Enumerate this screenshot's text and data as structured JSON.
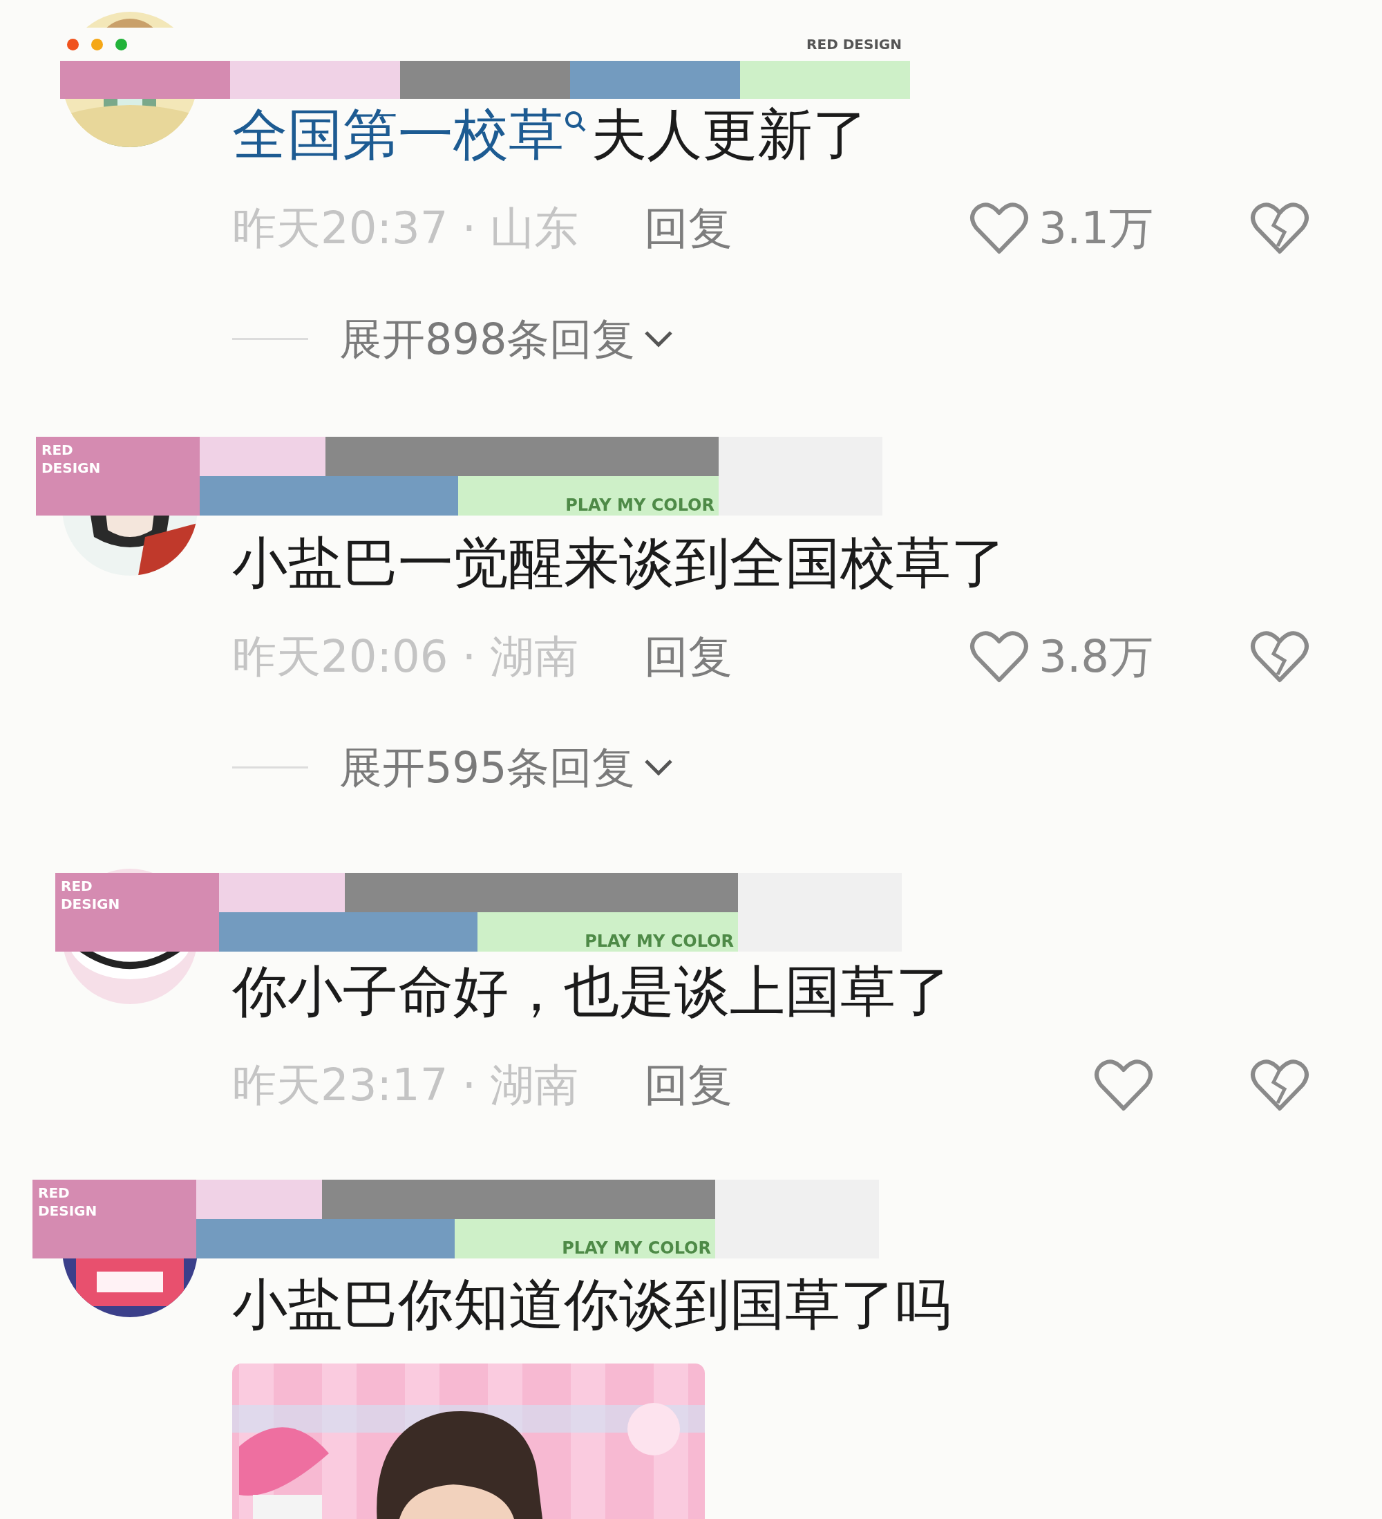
{
  "header_bar": {
    "label": "RED DESIGN"
  },
  "stickers": [
    {
      "label": "RED DESIGN",
      "caption": "PLAY MY COLOR"
    },
    {
      "label": "RED DESIGN",
      "caption": "PLAY MY COLOR"
    },
    {
      "label": "RED DESIGN",
      "caption": "PLAY MY COLOR"
    }
  ],
  "comments": [
    {
      "parts": [
        {
          "kind": "search_link",
          "text": "全国第一校草"
        },
        {
          "kind": "plain",
          "text": "夫人更新了"
        }
      ],
      "time_location": "昨天20:37 · 山东",
      "reply": "回复",
      "likes": "3.1万",
      "expand": "展开898条回复"
    },
    {
      "parts": [
        {
          "kind": "plain",
          "text": "小盐巴一觉醒来谈到全国校草了"
        }
      ],
      "time_location": "昨天20:06 · 湖南",
      "reply": "回复",
      "likes": "3.8万",
      "expand": "展开595条回复"
    },
    {
      "parts": [
        {
          "kind": "plain",
          "text": "你小子命好，也是谈上国草了"
        }
      ],
      "time_location": "昨天23:17 · 湖南",
      "reply": "回复"
    },
    {
      "parts": [
        {
          "kind": "plain",
          "text": "小盐巴你知道你谈到国草了吗"
        }
      ],
      "image": {
        "kind": "picture"
      }
    }
  ]
}
